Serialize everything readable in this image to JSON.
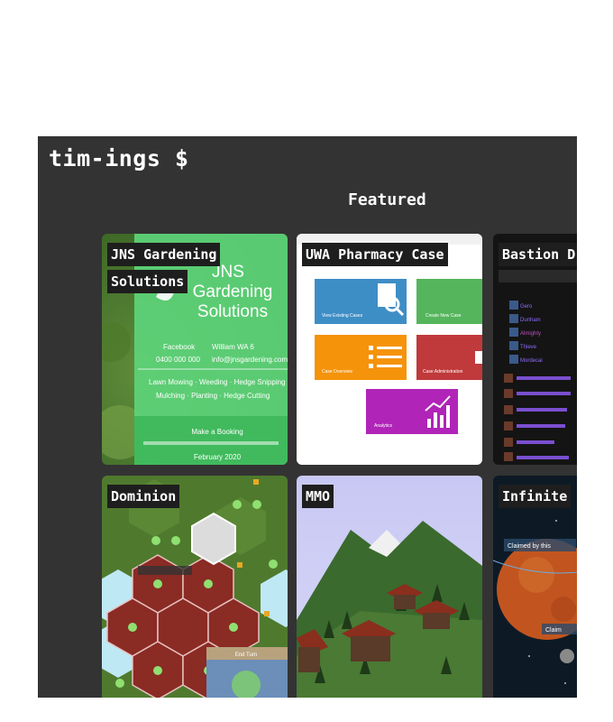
{
  "header": {
    "site_title": "tim-ings $"
  },
  "featured": {
    "heading": "Featured",
    "cards": [
      {
        "title": "JNS Gardening Solutions",
        "preview": {
          "headline": "JNS Gardening Solutions",
          "contact": [
            "Facebook",
            "William WA 6",
            "0400 000 000",
            "info@jnsgardening.com"
          ],
          "services": "Lawn Mowing · Weeding · Hedge Snipping",
          "services2": "Mulching · Planting · Hedge Cutting",
          "booking": "Make a Booking",
          "date": "February 2020"
        }
      },
      {
        "title": "UWA Pharmacy Case",
        "preview": {
          "tiles": [
            "View Existing Cases",
            "Create New Case",
            "Case Overview",
            "Case Administration",
            "Analytics"
          ],
          "colors": [
            "#3e8ec6",
            "#55b55c",
            "#f5930b",
            "#c0393b",
            "#b024b8"
          ]
        }
      },
      {
        "title": "Bastion D",
        "preview": {
          "rows": [
            "Gero",
            "Dunham",
            "Almighty",
            "Thieve",
            "Mordecai"
          ]
        }
      },
      {
        "title": "Dominion",
        "preview": {
          "panel": "End Turn"
        }
      },
      {
        "title": "MMO"
      },
      {
        "title": "Infinite",
        "preview": {
          "labels": [
            "Claimed by this",
            "Claim"
          ]
        }
      }
    ]
  }
}
